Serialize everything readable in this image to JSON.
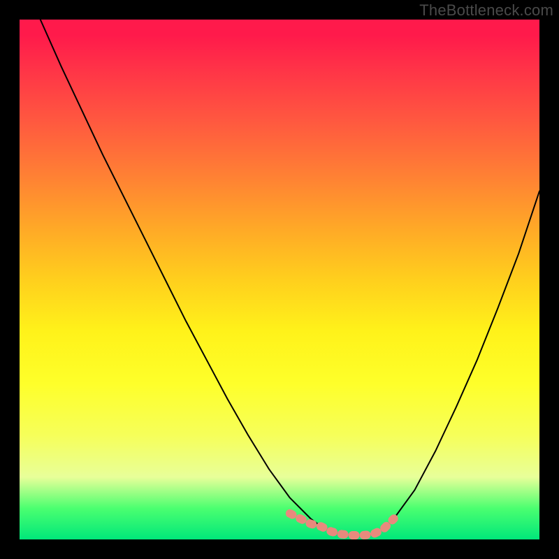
{
  "watermark": "TheBottleneck.com",
  "chart_data": {
    "type": "line",
    "title": "",
    "xlabel": "",
    "ylabel": "",
    "xlim": [
      0,
      100
    ],
    "ylim": [
      0,
      100
    ],
    "grid": false,
    "legend": false,
    "series": [
      {
        "name": "bottleneck-curve",
        "color": "#000000",
        "x": [
          4,
          8,
          12,
          16,
          20,
          24,
          28,
          32,
          36,
          40,
          44,
          48,
          52,
          56,
          58,
          60,
          62,
          64,
          66,
          68,
          70,
          72,
          76,
          80,
          84,
          88,
          92,
          96,
          100
        ],
        "y": [
          100,
          91,
          82.5,
          74,
          66,
          58,
          50,
          42,
          34.5,
          27,
          20,
          13.5,
          8,
          4,
          2.5,
          1.5,
          1,
          0.8,
          0.8,
          1,
          2,
          4,
          9.5,
          17,
          25.5,
          34.5,
          44.5,
          55,
          67
        ]
      },
      {
        "name": "highlight-band",
        "color": "#e88a7d",
        "x": [
          52,
          54,
          56,
          58,
          60,
          62,
          64,
          66,
          68,
          70,
          72
        ],
        "y": [
          5,
          4,
          3,
          2.5,
          1.5,
          1,
          0.8,
          0.8,
          1,
          2,
          4
        ]
      }
    ],
    "annotations": []
  },
  "colors": {
    "background": "#000000",
    "gradient_top": "#ff1a4b",
    "gradient_bottom": "#00e77a",
    "curve": "#000000",
    "highlight": "#e88a7d",
    "watermark": "#4a4a4a"
  }
}
